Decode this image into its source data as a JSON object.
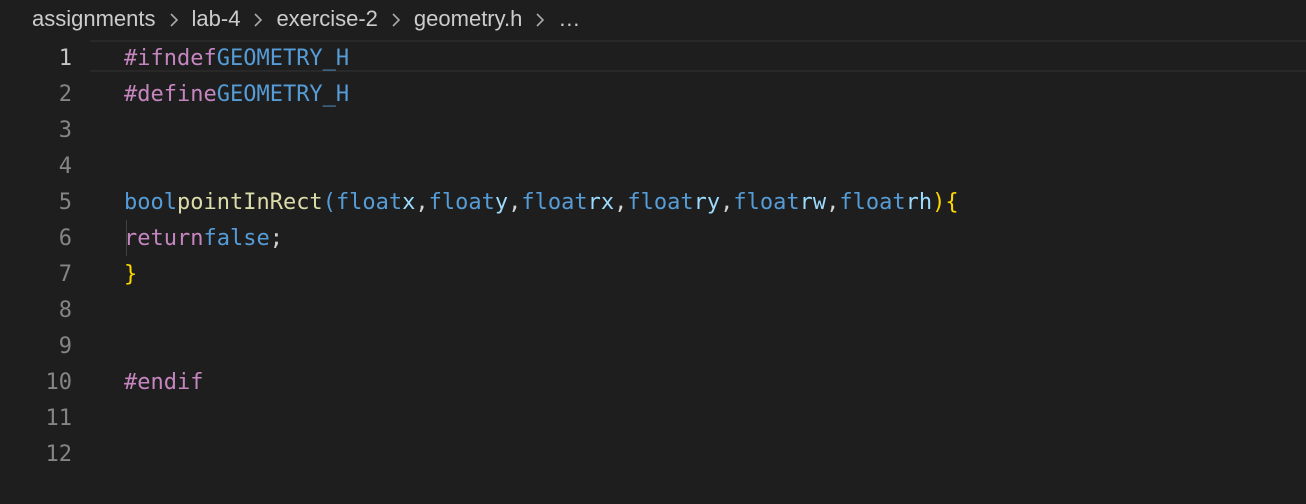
{
  "breadcrumb": {
    "items": [
      "assignments",
      "lab-4",
      "exercise-2",
      "geometry.h"
    ],
    "more": "…"
  },
  "editor": {
    "active_line": 1,
    "line_numbers": [
      "1",
      "2",
      "3",
      "4",
      "5",
      "6",
      "7",
      "8",
      "9",
      "10",
      "11",
      "12"
    ],
    "lines": {
      "l1": {
        "directive": "#ifndef",
        "macro": "GEOMETRY_H"
      },
      "l2": {
        "directive": "#define",
        "macro": "GEOMETRY_H"
      },
      "l5": {
        "return_type": "bool",
        "func": "pointInRect",
        "open_paren": "(",
        "params": [
          {
            "type": "float",
            "name": "x"
          },
          {
            "type": "float",
            "name": "y"
          },
          {
            "type": "float",
            "name": "rx"
          },
          {
            "type": "float",
            "name": "ry"
          },
          {
            "type": "float",
            "name": "rw"
          },
          {
            "type": "float",
            "name": "rh"
          }
        ],
        "comma": ",",
        "close_paren": ")",
        "open_brace": "{"
      },
      "l6": {
        "keyword": "return",
        "value": "false",
        "semicolon": ";"
      },
      "l7": {
        "close_brace": "}"
      },
      "l10": {
        "directive": "#endif"
      }
    }
  },
  "colors": {
    "background": "#1e1e1e",
    "directive": "#c586c0",
    "type": "#569cd6",
    "function": "#dcdcaa",
    "parameter": "#9cdcfe",
    "brace": "#ffd700",
    "line_number": "#858585"
  }
}
